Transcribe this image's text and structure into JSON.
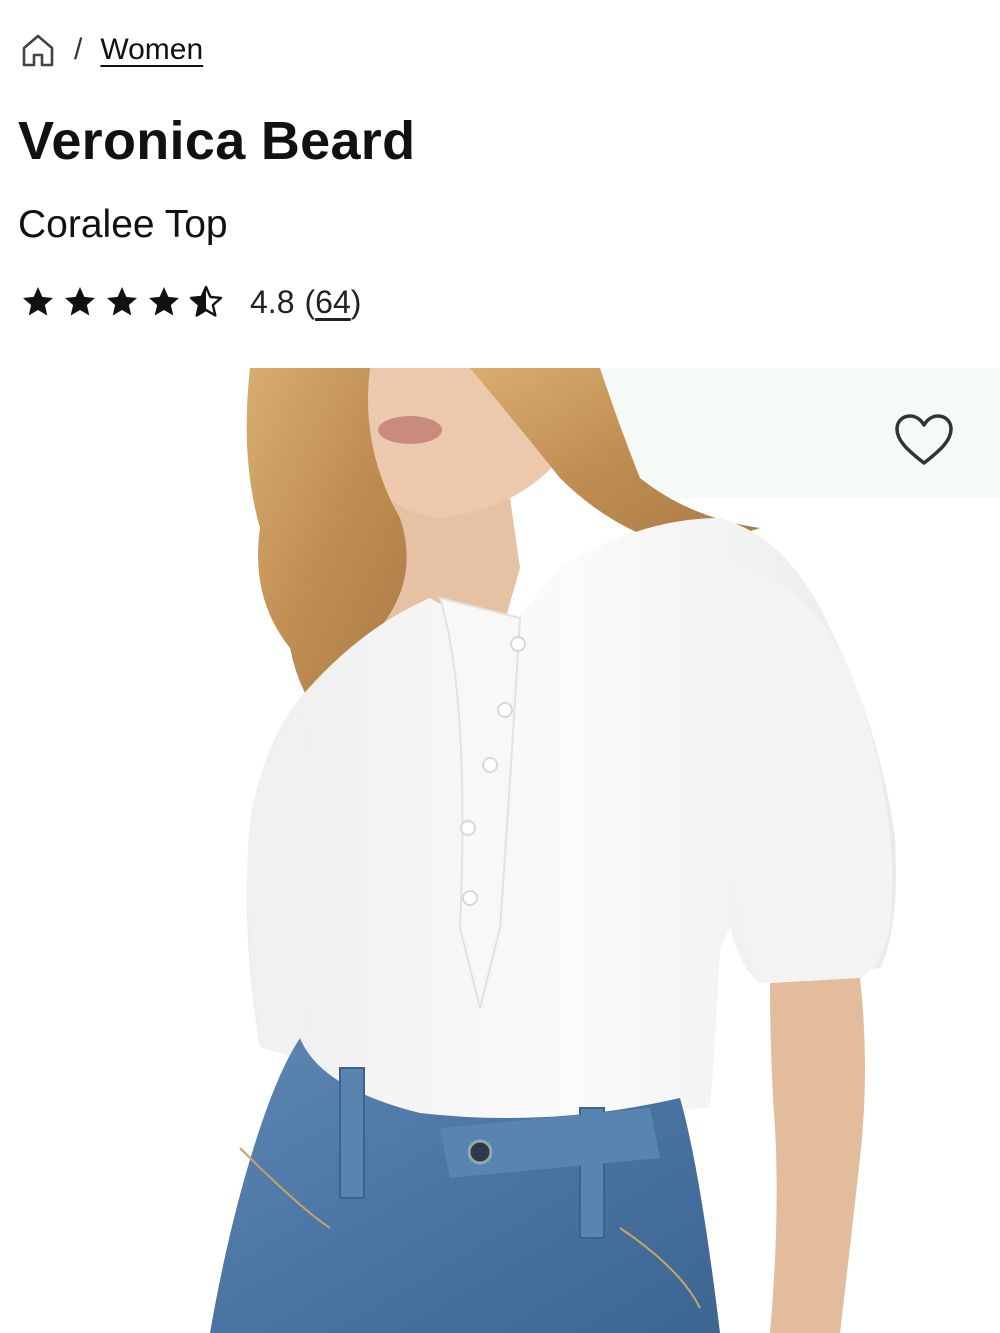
{
  "breadcrumb": {
    "home_icon": "home-icon",
    "separator": "/",
    "category": "Women"
  },
  "product": {
    "brand": "Veronica Beard",
    "name": "Coralee Top",
    "rating": {
      "stars_filled": 4.5,
      "stars_total": 5,
      "value": "4.8",
      "count_open": "(",
      "count": "64",
      "count_close": ")"
    }
  },
  "image": {
    "description_icon": "product-photo",
    "wishlist_icon": "heart-icon"
  },
  "colors": {
    "text": "#111111",
    "star": "#111111",
    "shirt": "#f7f7f7",
    "denim": "#4f79a6",
    "hair": "#c89a5c",
    "skin": "#e7c3a6"
  }
}
